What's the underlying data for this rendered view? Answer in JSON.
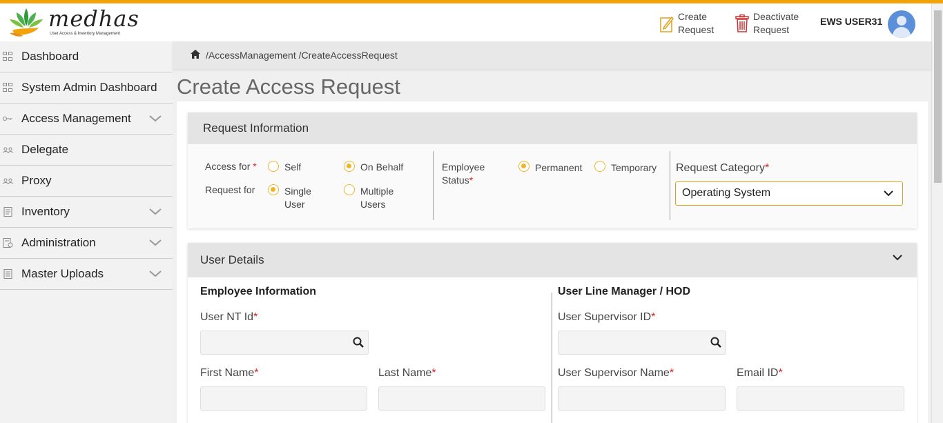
{
  "header": {
    "logo_text": "medhas",
    "logo_subtitle": "User Access & Inventory Management",
    "create_request_label": "Create Request",
    "deactivate_request_label": "Deactivate Request",
    "user_name": "EWS USER31"
  },
  "sidebar": {
    "items": [
      {
        "label": "Dashboard",
        "icon": "grid-icon",
        "expandable": false
      },
      {
        "label": "System Admin Dashboard",
        "icon": "grid-icon",
        "expandable": false
      },
      {
        "label": "Access Management",
        "icon": "key-icon",
        "expandable": true
      },
      {
        "label": "Delegate",
        "icon": "users-icon",
        "expandable": false
      },
      {
        "label": "Proxy",
        "icon": "users-icon",
        "expandable": false
      },
      {
        "label": "Inventory",
        "icon": "document-icon",
        "expandable": true
      },
      {
        "label": "Administration",
        "icon": "admin-doc-icon",
        "expandable": true
      },
      {
        "label": "Master Uploads",
        "icon": "upload-doc-icon",
        "expandable": true
      }
    ]
  },
  "breadcrumb": {
    "path": "/AccessManagement /CreateAccessRequest"
  },
  "page": {
    "title": "Create Access Request"
  },
  "request_info": {
    "title": "Request Information",
    "access_for_label": "Access for ",
    "access_for_options": [
      "Self",
      "On Behalf"
    ],
    "access_for_selected": "On Behalf",
    "request_for_label": "Request for",
    "request_for_options": [
      "Single User",
      "Multiple Users"
    ],
    "request_for_selected": "Single User",
    "employee_status_label": "Employee Status",
    "employee_status_options": [
      "Permanent",
      "Temporary"
    ],
    "employee_status_selected": "Permanent",
    "request_category_label": "Request Category",
    "request_category_value": "Operating System",
    "required_mark": "*"
  },
  "user_details": {
    "title": "User Details",
    "employee_info_title": "Employee Information",
    "manager_title": "User Line Manager / HOD",
    "user_nt_id_label": "User NT Id",
    "first_name_label": "First Name",
    "last_name_label": "Last Name",
    "supervisor_id_label": "User Supervisor ID",
    "supervisor_name_label": "User Supervisor Name",
    "email_id_label": "Email ID"
  },
  "colors": {
    "accent": "#f0a30a",
    "radio": "#f0b429",
    "required": "#e02020",
    "avatar": "#5b8fd9"
  }
}
